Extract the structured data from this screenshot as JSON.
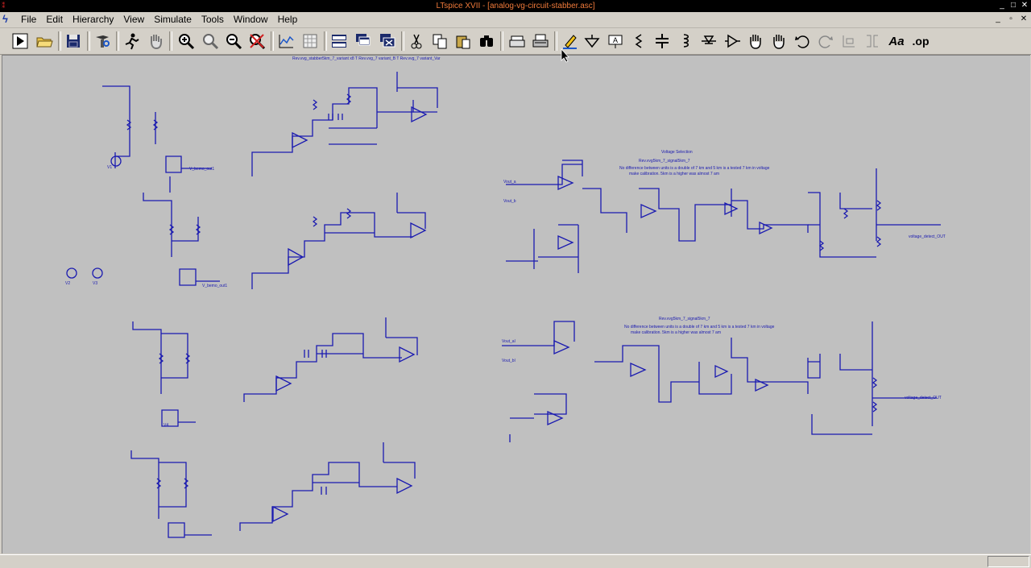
{
  "window": {
    "title": "LTspice XVII - [analog-vg-circuit-stabber.asc]",
    "controls": [
      "_",
      "□",
      "✕"
    ]
  },
  "menu": {
    "items": [
      "File",
      "Edit",
      "Hierarchy",
      "View",
      "Simulate",
      "Tools",
      "Window",
      "Help"
    ],
    "mdi_controls": [
      "_",
      "▫",
      "✕"
    ]
  },
  "toolbar": {
    "buttons": [
      {
        "name": "run-icon"
      },
      {
        "name": "open-folder-icon"
      },
      {
        "name": "save-icon"
      },
      {
        "name": "control-panel-icon"
      },
      {
        "name": "halt-icon"
      },
      {
        "name": "pan-hand-icon"
      },
      {
        "name": "zoom-in-icon"
      },
      {
        "name": "zoom-pan-icon"
      },
      {
        "name": "zoom-out-icon"
      },
      {
        "name": "zoom-cancel-icon"
      },
      {
        "name": "autorange-icon"
      },
      {
        "name": "grid-icon"
      },
      {
        "name": "tile-vertical-icon"
      },
      {
        "name": "cascade-icon"
      },
      {
        "name": "close-windows-icon"
      },
      {
        "name": "cut-icon"
      },
      {
        "name": "copy-icon"
      },
      {
        "name": "paste-icon"
      },
      {
        "name": "find-icon"
      },
      {
        "name": "print-setup-icon"
      },
      {
        "name": "print-icon"
      },
      {
        "name": "draw-wire-icon"
      },
      {
        "name": "ground-icon"
      },
      {
        "name": "label-net-icon"
      },
      {
        "name": "resistor-icon"
      },
      {
        "name": "capacitor-icon"
      },
      {
        "name": "inductor-icon"
      },
      {
        "name": "diode-icon"
      },
      {
        "name": "component-icon"
      },
      {
        "name": "move-icon"
      },
      {
        "name": "drag-icon"
      },
      {
        "name": "undo-icon"
      },
      {
        "name": "redo-icon"
      },
      {
        "name": "rotate-icon"
      },
      {
        "name": "mirror-icon"
      },
      {
        "name": "text-icon"
      },
      {
        "name": "spice-directive-icon"
      }
    ],
    "text_label": "Aa",
    "spice_label": ".op"
  },
  "schematic": {
    "top_comment": "Rev.vvg_stabber5km_7_variant x8 T Rev.vvg_7 variant_B T Rev.vvg_7 variant_Var",
    "section_a_title": "Voltage Selection",
    "section_a_note1": "Rev.vvg5km_7_signal5km_7",
    "section_a_note2": "No difference between units is a double of 7 km and 5 km is a tested 7 km in voltage",
    "section_a_note3": "make calibration. 5km is a higher was almost 7 am",
    "section_b_note1": "Rev.vvg5km_7_signal5km_7",
    "section_b_note2": "No difference between units is a double of 7 km and 5 km is a tested 7 km in voltage",
    "section_b_note3": "make calibration. 5km is a higher was almost 7 am",
    "labels_small": [
      "V_bemo_out1",
      "Vout_a",
      "Vout_b",
      "V_bemo_out1",
      "Vout_al",
      "Vout_bl",
      "V1",
      "V2",
      "V3",
      "V4"
    ],
    "output_labels": [
      "voltage_detect_OUT",
      "voltage_detect_OUT"
    ],
    "accent_color": "#1a1ab0"
  }
}
